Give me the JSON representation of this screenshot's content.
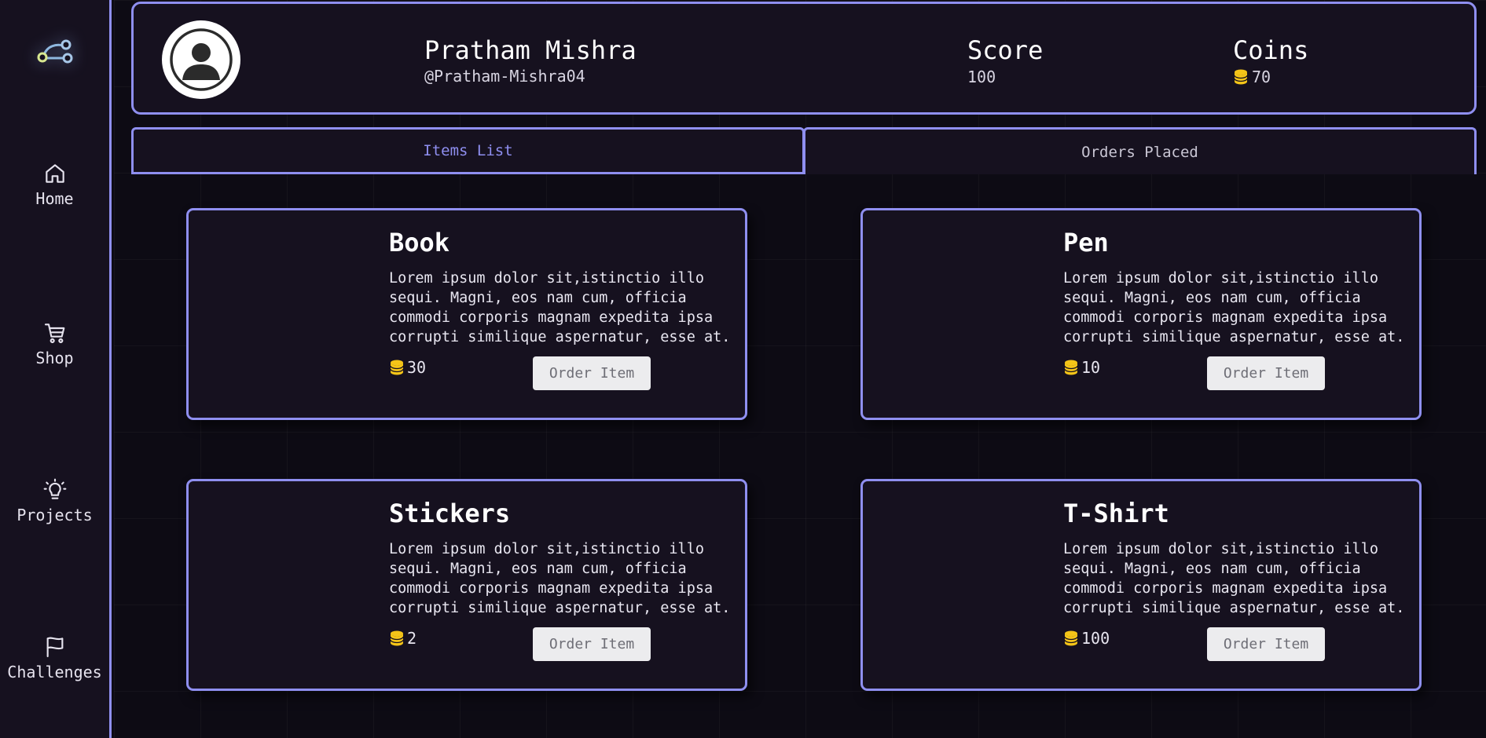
{
  "sidebar": {
    "logo_icon": "graph-nodes-logo",
    "items": [
      {
        "label": "Home",
        "icon": "home-icon"
      },
      {
        "label": "Shop",
        "icon": "cart-icon"
      },
      {
        "label": "Projects",
        "icon": "lightbulb-icon"
      },
      {
        "label": "Challenges",
        "icon": "flag-icon"
      }
    ]
  },
  "profile": {
    "name": "Pratham Mishra",
    "handle": "@Pratham-Mishra04",
    "score_label": "Score",
    "score_value": "100",
    "coins_label": "Coins",
    "coins_value": "70"
  },
  "tabs": [
    {
      "label": "Items List",
      "active": true
    },
    {
      "label": "Orders Placed",
      "active": false
    }
  ],
  "items": [
    {
      "title": "Book",
      "description": "Lorem ipsum dolor sit,istinctio illo sequi. Magni, eos nam cum, officia commodi corporis magnam expedita ipsa corrupti similique aspernatur, esse at.",
      "price": "30",
      "button": "Order Item"
    },
    {
      "title": "Pen",
      "description": "Lorem ipsum dolor sit,istinctio illo sequi. Magni, eos nam cum, officia commodi corporis magnam expedita ipsa corrupti similique aspernatur, esse at.",
      "price": "10",
      "button": "Order Item"
    },
    {
      "title": "Stickers",
      "description": "Lorem ipsum dolor sit,istinctio illo sequi. Magni, eos nam cum, officia commodi corporis magnam expedita ipsa corrupti similique aspernatur, esse at.",
      "price": "2",
      "button": "Order Item"
    },
    {
      "title": "T-Shirt",
      "description": "Lorem ipsum dolor sit,istinctio illo sequi. Magni, eos nam cum, officia commodi corporis magnam expedita ipsa corrupti similique aspernatur, esse at.",
      "price": "100",
      "button": "Order Item"
    }
  ],
  "colors": {
    "accent": "#8f8ff0",
    "panel": "#16111f",
    "background": "#0d0b14",
    "coin": "#f5c518"
  }
}
